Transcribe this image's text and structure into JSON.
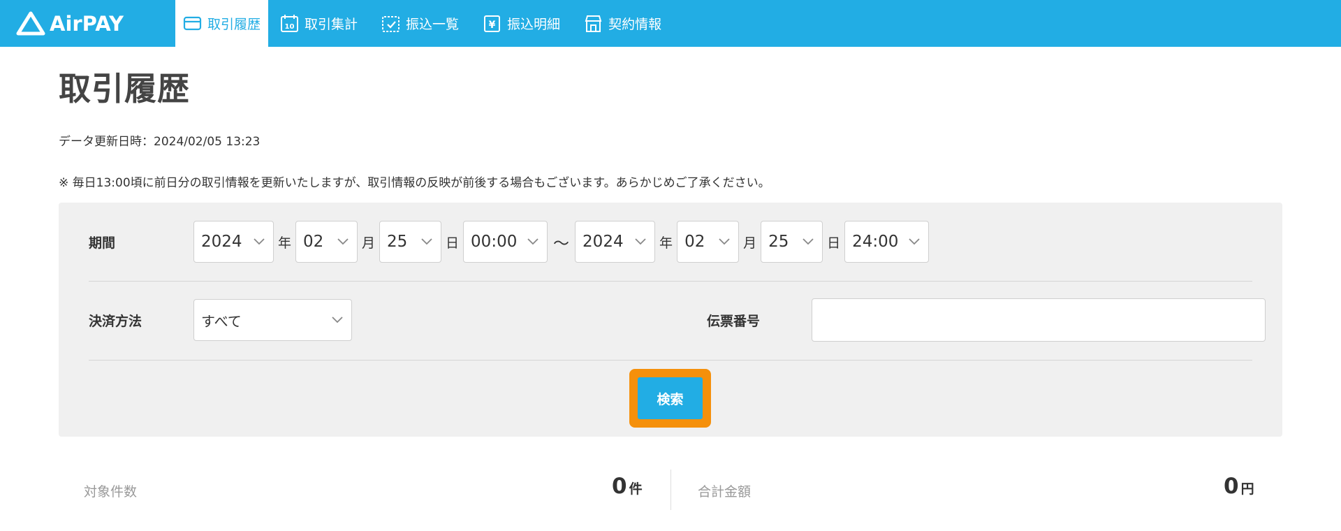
{
  "brand": {
    "name": "AirPAY",
    "color": "#22ade4",
    "logo_icon": "triangle-logo-icon"
  },
  "nav": [
    {
      "label": "取引履歴",
      "icon": "card-icon",
      "active": true
    },
    {
      "label": "取引集計",
      "icon": "calendar-10-icon",
      "active": false
    },
    {
      "label": "振込一覧",
      "icon": "calendar-check-icon",
      "active": false
    },
    {
      "label": "振込明細",
      "icon": "yen-doc-icon",
      "active": false
    },
    {
      "label": "契約情報",
      "icon": "shop-icon",
      "active": false
    }
  ],
  "page": {
    "title": "取引履歴",
    "updated": "データ更新日時：2024/02/05 13:23",
    "notice": "※ 毎日13:00頃に前日分の取引情報を更新いたしますが、取引情報の反映が前後する場合もございます。あらかじめご了承ください。"
  },
  "search": {
    "period_label": "期間",
    "from": {
      "year": "2024",
      "month": "02",
      "day": "25",
      "time": "00:00"
    },
    "to": {
      "year": "2024",
      "month": "02",
      "day": "25",
      "time": "24:00"
    },
    "units": {
      "year": "年",
      "month": "月",
      "day": "日",
      "range": "〜"
    },
    "payment_label": "決済方法",
    "payment_value": "すべて",
    "slip_label": "伝票番号",
    "slip_value": "",
    "button_label": "検索",
    "highlight_color": "#f5900b"
  },
  "summary": {
    "count_label": "対象件数",
    "count_value": "0",
    "count_unit": "件",
    "total_label": "合計金額",
    "total_value": "0",
    "total_unit": "円"
  }
}
